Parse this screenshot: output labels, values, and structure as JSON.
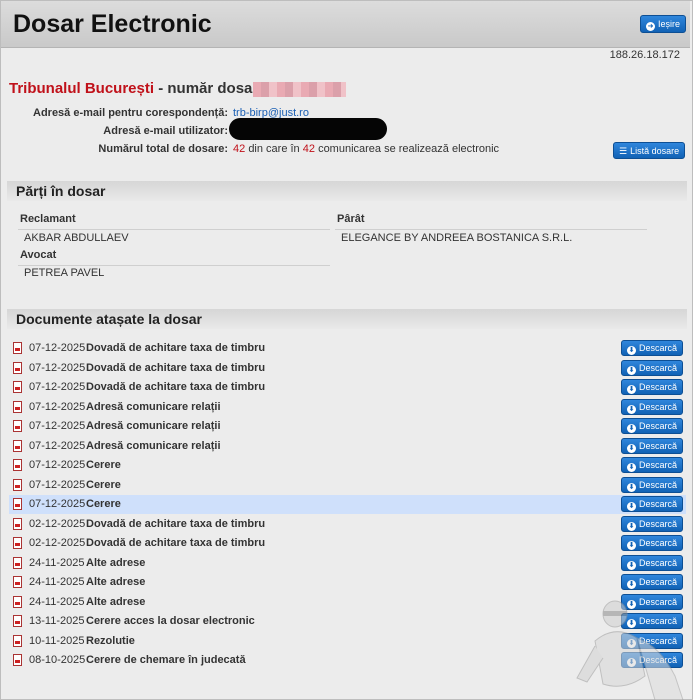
{
  "header": {
    "title": "Dosar Electronic",
    "exit_label": "Ieșire",
    "ip": "188.26.18.172"
  },
  "case": {
    "court": "Tribunalul București",
    "case_number_label": "- număr dosar:",
    "fields": [
      {
        "label": "Adresă e-mail pentru corespondență:",
        "value": "trb-birp@just.ro"
      },
      {
        "label": "Adresă e-mail utilizator:",
        "value": ""
      },
      {
        "label": "Numărul total de dosare:",
        "count": "42",
        "middle": "din care în",
        "count2": "42",
        "suffix": "comunicarea se realizează electronic"
      }
    ],
    "list_button": "Listă dosare"
  },
  "parties": {
    "section_title": "Părți în dosar",
    "claimant_label": "Reclamant",
    "claimant": "AKBAR ABDULLAEV",
    "lawyer_label": "Avocat",
    "lawyer": "PETREA PAVEL",
    "defendant_label": "Pârât",
    "defendant": "ELEGANCE BY ANDREEA BOSTANICA S.R.L."
  },
  "documents": {
    "section_title": "Documente atașate la dosar",
    "download_label": "Descarcă",
    "items": [
      {
        "date": "07-12-2025",
        "name": "Dovadă de achitare taxa de timbru"
      },
      {
        "date": "07-12-2025",
        "name": "Dovadă de achitare taxa de timbru"
      },
      {
        "date": "07-12-2025",
        "name": "Dovadă de achitare taxa de timbru"
      },
      {
        "date": "07-12-2025",
        "name": "Adresă comunicare relații"
      },
      {
        "date": "07-12-2025",
        "name": "Adresă comunicare relații"
      },
      {
        "date": "07-12-2025",
        "name": "Adresă comunicare relații"
      },
      {
        "date": "07-12-2025",
        "name": "Cerere"
      },
      {
        "date": "07-12-2025",
        "name": "Cerere"
      },
      {
        "date": "07-12-2025",
        "name": "Cerere"
      },
      {
        "date": "02-12-2025",
        "name": "Dovadă de achitare taxa de timbru"
      },
      {
        "date": "02-12-2025",
        "name": "Dovadă de achitare taxa de timbru"
      },
      {
        "date": "24-11-2025",
        "name": "Alte adrese"
      },
      {
        "date": "24-11-2025",
        "name": "Alte adrese"
      },
      {
        "date": "24-11-2025",
        "name": "Alte adrese"
      },
      {
        "date": "13-11-2025",
        "name": "Cerere acces la dosar electronic"
      },
      {
        "date": "10-11-2025",
        "name": "Rezolutie"
      },
      {
        "date": "08-10-2025",
        "name": "Cerere de chemare în judecată"
      }
    ],
    "selected_index": 8
  },
  "colors": {
    "accent": "#1162b5",
    "court_red": "#c0111a",
    "selected_row": "#cfe0fb"
  }
}
